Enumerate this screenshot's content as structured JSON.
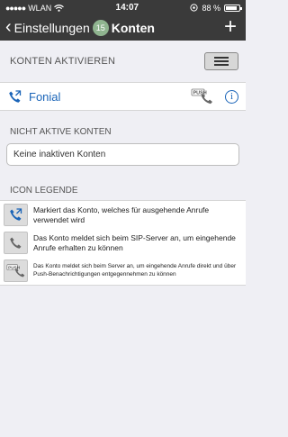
{
  "status_bar": {
    "carrier": "WLAN",
    "time": "14:07",
    "battery": "88 %"
  },
  "nav": {
    "back_label": "Einstellungen",
    "badge": "15",
    "title": "Konten"
  },
  "active_section": {
    "heading": "KONTEN AKTIVIEREN",
    "accounts": [
      {
        "name": "Fonial"
      }
    ]
  },
  "inactive_section": {
    "heading": "NICHT AKTIVE KONTEN",
    "empty_text": "Keine inaktiven Konten"
  },
  "legend": {
    "heading": "ICON LEGENDE",
    "items": [
      {
        "text": "Markiert das Konto, welches für ausgehende Anrufe verwendet wird"
      },
      {
        "text": "Das Konto meldet sich beim SIP-Server an, um eingehende Anrufe erhalten zu können"
      },
      {
        "text": "Das Konto meldet sich beim Server an, um eingehende Anrufe direkt und über Push-Benachrichtigungen entgegennehmen zu können"
      }
    ]
  },
  "colors": {
    "bar": "#3a3a3a",
    "accent": "#1a64b8",
    "badge": "#8fb48f",
    "background": "#efeff4"
  }
}
